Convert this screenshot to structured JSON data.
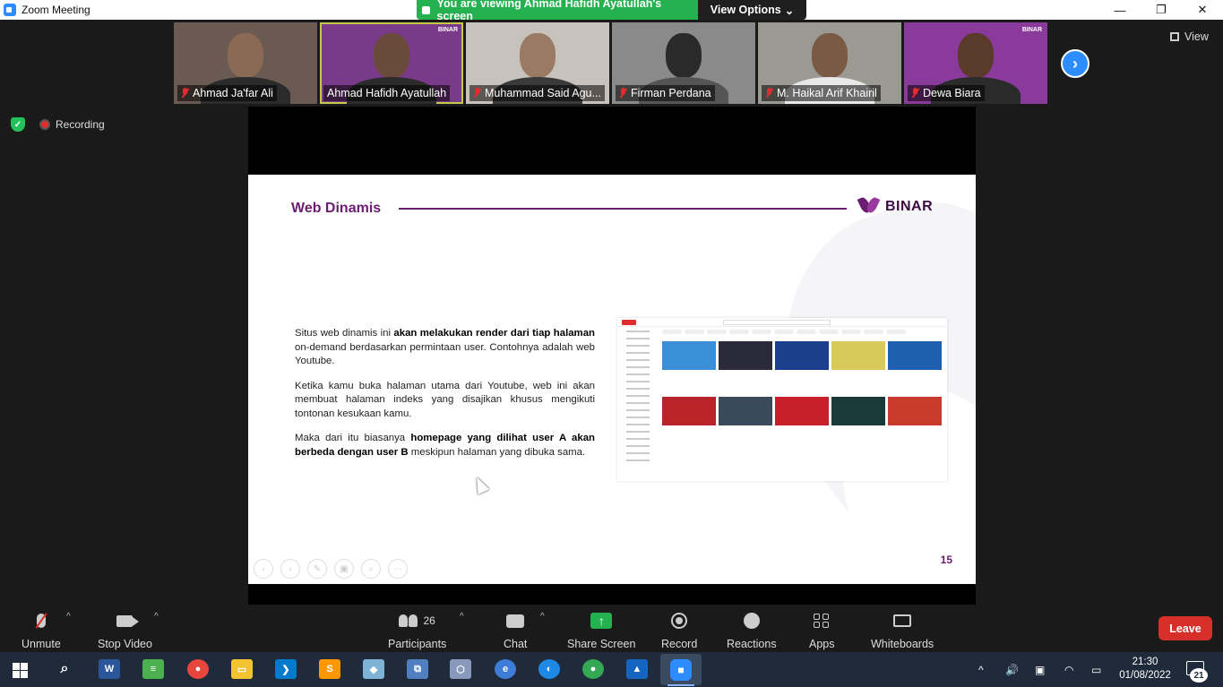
{
  "window": {
    "title": "Zoom Meeting",
    "minimize_glyph": "—",
    "restore_glyph": "❐",
    "close_glyph": "✕"
  },
  "share_banner": {
    "message": "You are viewing Ahmad Hafidh Ayatullah's screen",
    "view_options": "View Options",
    "chevron": "⌄"
  },
  "participants_strip": [
    {
      "name": "Ahmad Ja'far Ali",
      "muted": true,
      "bg": "#6b5a52"
    },
    {
      "name": "Ahmad Hafidh Ayatullah",
      "muted": false,
      "bg": "#7a3a8a",
      "active": true
    },
    {
      "name": "Muhammad Said Agu...",
      "muted": true,
      "bg": "#c8c2bc"
    },
    {
      "name": "Firman Perdana",
      "muted": true,
      "bg": "#8a8a8a"
    },
    {
      "name": "M. Haikal Arif Khairil",
      "muted": true,
      "bg": "#9a9a92"
    },
    {
      "name": "Dewa Biara",
      "muted": true,
      "bg": "#8a3a9a"
    }
  ],
  "binar_mini": "BINAR",
  "next_glyph": "›",
  "view_label": "View",
  "recording_label": "Recording",
  "slide": {
    "title": "Web Dinamis",
    "brand": "BINAR",
    "para1_a": "Situs web dinamis ini ",
    "para1_b": "akan melakukan render dari tiap halaman",
    "para1_c": " on-demand berdasarkan permintaan user. Contohnya adalah web Youtube.",
    "para2": "Ketika kamu buka halaman utama dari Youtube, web ini akan membuat halaman indeks yang disajikan khusus mengikuti tontonan kesukaan kamu.",
    "para3_a": "Maka dari itu biasanya ",
    "para3_b": "homepage yang dilihat user A akan berbeda dengan user B",
    "para3_c": " meskipun halaman yang dibuka sama.",
    "page_number": "15",
    "nav_glyphs": [
      "‹",
      "›",
      "✎",
      "▣",
      "⌕",
      "⋯"
    ]
  },
  "toolbar": {
    "unmute": "Unmute",
    "stop_video": "Stop Video",
    "participants": "Participants",
    "participants_count": "26",
    "chat": "Chat",
    "share_screen": "Share Screen",
    "record": "Record",
    "reactions": "Reactions",
    "apps": "Apps",
    "whiteboards": "Whiteboards",
    "leave": "Leave",
    "caret": "^",
    "share_arrow": "↑"
  },
  "taskbar": {
    "apps": [
      {
        "name": "search",
        "glyph": "⌕",
        "color": "transparent"
      },
      {
        "name": "word",
        "glyph": "W",
        "color": "#2b579a"
      },
      {
        "name": "notepad",
        "glyph": "≡",
        "color": "#4caf50"
      },
      {
        "name": "chrome",
        "glyph": "●",
        "color": "#e8453c"
      },
      {
        "name": "file-explorer",
        "glyph": "▭",
        "color": "#f4c430"
      },
      {
        "name": "vscode",
        "glyph": "❯",
        "color": "#007acc"
      },
      {
        "name": "sublime",
        "glyph": "S",
        "color": "#ff9800"
      },
      {
        "name": "tool",
        "glyph": "◆",
        "color": "#7fb3d5"
      },
      {
        "name": "network",
        "glyph": "⧉",
        "color": "#4f7fbf"
      },
      {
        "name": "virtualbox",
        "glyph": "⬡",
        "color": "#8899bb"
      },
      {
        "name": "edge",
        "glyph": "e",
        "color": "#3d7dd8"
      },
      {
        "name": "browser",
        "glyph": "◐",
        "color": "#1e88e5"
      },
      {
        "name": "chrome-2",
        "glyph": "●",
        "color": "#34a853"
      },
      {
        "name": "photos",
        "glyph": "▲",
        "color": "#1565c0"
      },
      {
        "name": "zoom",
        "glyph": "■",
        "color": "#2d8cff"
      }
    ],
    "tray_up": "^",
    "volume": "🔊",
    "time": "21:30",
    "date": "01/08/2022",
    "notifications": "21"
  }
}
